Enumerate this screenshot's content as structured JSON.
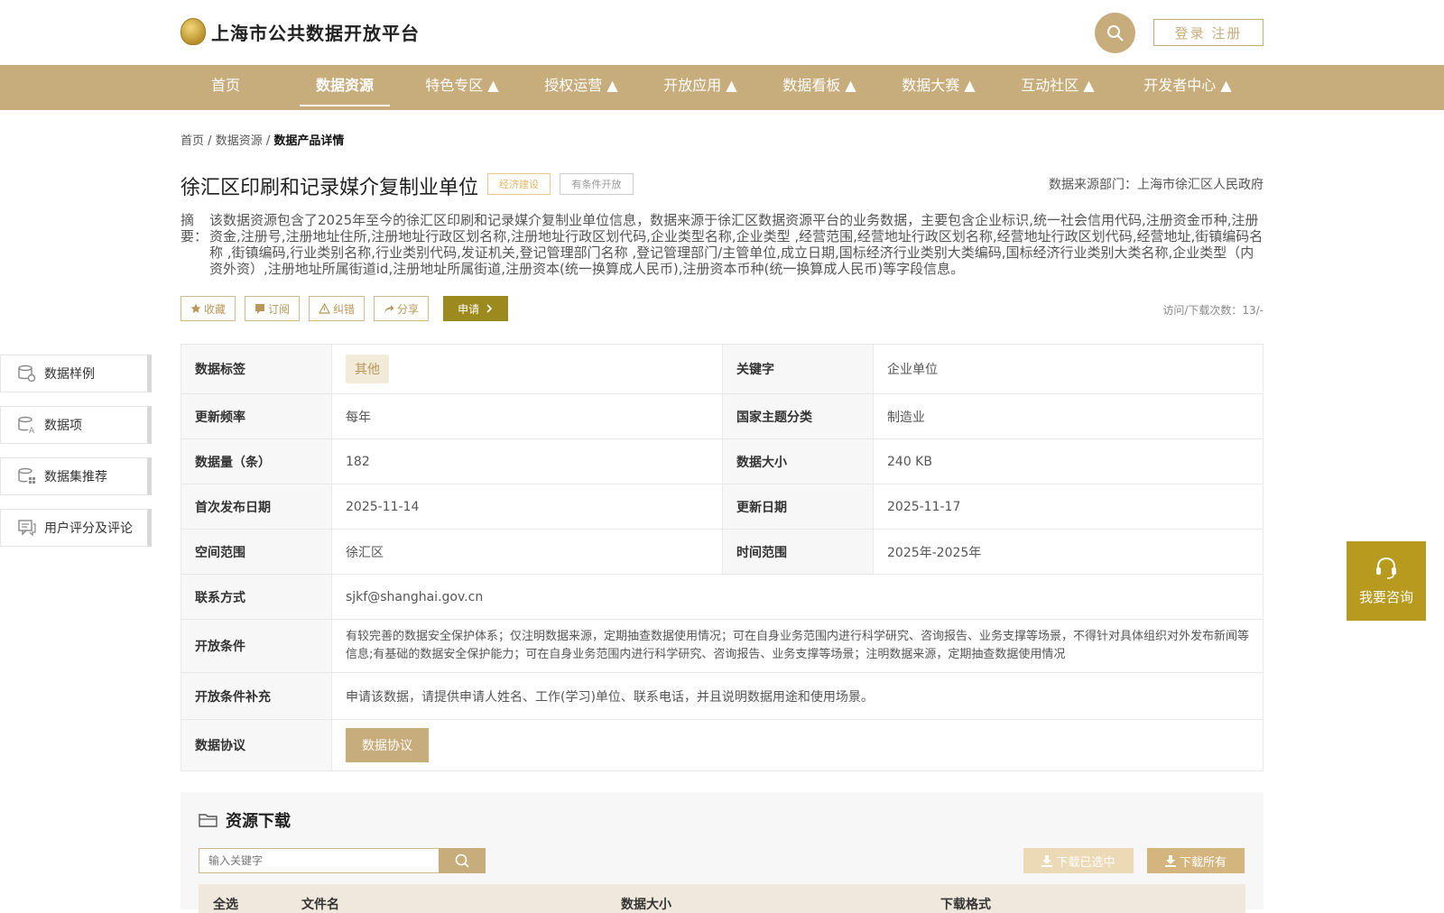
{
  "header": {
    "site_title": "上海市公共数据开放平台",
    "login_label": "登录 注册"
  },
  "nav": {
    "items": [
      "首页",
      "数据资源",
      "特色专区 ▲",
      "授权运营 ▲",
      "开放应用 ▲",
      "数据看板 ▲",
      "数据大赛 ▲",
      "互动社区 ▲",
      "开发者中心 ▲"
    ],
    "active": "数据资源"
  },
  "breadcrumb": {
    "home": "首页",
    "resources": "数据资源",
    "current": "数据产品详情",
    "sep": "/"
  },
  "dataset": {
    "title": "徐汇区印刷和记录媒介复制业单位",
    "tag1": "经济建设",
    "tag2": "有条件开放",
    "source": "数据来源部门：上海市徐汇区人民政府",
    "summary_label": "摘要：",
    "summary": "该数据资源包含了2025年至今的徐汇区印刷和记录媒介复制业单位信息，数据来源于徐汇区数据资源平台的业务数据，主要包含企业标识,统一社会信用代码,注册资金币种,注册资金,注册号,注册地址住所,注册地址行政区划名称,注册地址行政区划代码,企业类型名称,企业类型 ,经营范围,经营地址行政区划名称,经营地址行政区划代码,经营地址,街镇编码名称 ,街镇编码,行业类别名称,行业类别代码,发证机关,登记管理部门名称 ,登记管理部门/主管单位,成立日期,国标经济行业类别大类编码,国标经济行业类别大类名称,企业类型（内资外资）,注册地址所属街道id,注册地址所属街道,注册资本(统一换算成人民币),注册资本币种(统一换算成人民币)等字段信息。"
  },
  "actions": {
    "favorite": "收藏",
    "subscribe": "订阅",
    "report": "纠错",
    "share": "分享",
    "apply": "申请"
  },
  "visits": "访问/下载次数：13/-",
  "sidebar": {
    "items": [
      "数据样例",
      "数据项",
      "数据集推荐",
      "用户评分及评论"
    ]
  },
  "info": {
    "label_k": "数据标签",
    "label_v": "其他",
    "keyword_k": "关键字",
    "keyword_v": "企业单位",
    "freq_k": "更新频率",
    "freq_v": "每年",
    "theme_k": "国家主题分类",
    "theme_v": "制造业",
    "count_k": "数据量（条）",
    "count_v": "182",
    "size_k": "数据大小",
    "size_v": "240 KB",
    "pub_k": "首次发布日期",
    "pub_v": "2025-11-14",
    "upd_k": "更新日期",
    "upd_v": "2025-11-17",
    "space_k": "空间范围",
    "space_v": "徐汇区",
    "time_k": "时间范围",
    "time_v": "2025年-2025年",
    "contact_k": "联系方式",
    "contact_v": "sjkf@shanghai.gov.cn",
    "cond_k": "开放条件",
    "cond_v": "有较完善的数据安全保护体系；仅注明数据来源，定期抽查数据使用情况；可在自身业务范围内进行科学研究、咨询报告、业务支撑等场景，不得针对具体组织对外发布新闻等信息;有基础的数据安全保护能力；可在自身业务范围内进行科学研究、咨询报告、业务支撑等场景；注明数据来源，定期抽查数据使用情况",
    "cond2_k": "开放条件补充",
    "cond2_v": "申请该数据，请提供申请人姓名、工作(学习)单位、联系电话，并且说明数据用途和使用场景。",
    "proto_k": "数据协议",
    "proto_btn": "数据协议"
  },
  "download": {
    "title": "资源下载",
    "placeholder": "输入关键字",
    "download_selected": "下载已选中",
    "download_all": "下载所有",
    "columns": [
      "全选",
      "文件名",
      "数据大小",
      "下载格式"
    ]
  },
  "consult": "我要咨询",
  "colors": {
    "primary": "#c8ad7c",
    "apply": "#9c8a1e",
    "consult": "#b89a1e"
  }
}
